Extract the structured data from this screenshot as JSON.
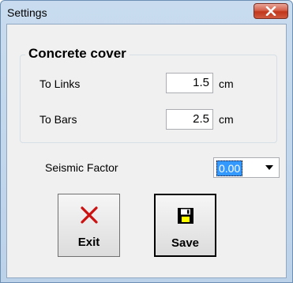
{
  "window": {
    "title": "Settings"
  },
  "concrete_cover": {
    "title": "Concrete cover",
    "to_links": {
      "label": "To Links",
      "value": "1.5",
      "unit": "cm"
    },
    "to_bars": {
      "label": "To Bars",
      "value": "2.5",
      "unit": "cm"
    }
  },
  "seismic": {
    "label": "Seismic Factor",
    "value": "0.00"
  },
  "buttons": {
    "exit": "Exit",
    "save": "Save"
  },
  "colors": {
    "selection": "#3399ff",
    "exit_icon": "#cc1111",
    "close_button": "#c9432b"
  }
}
